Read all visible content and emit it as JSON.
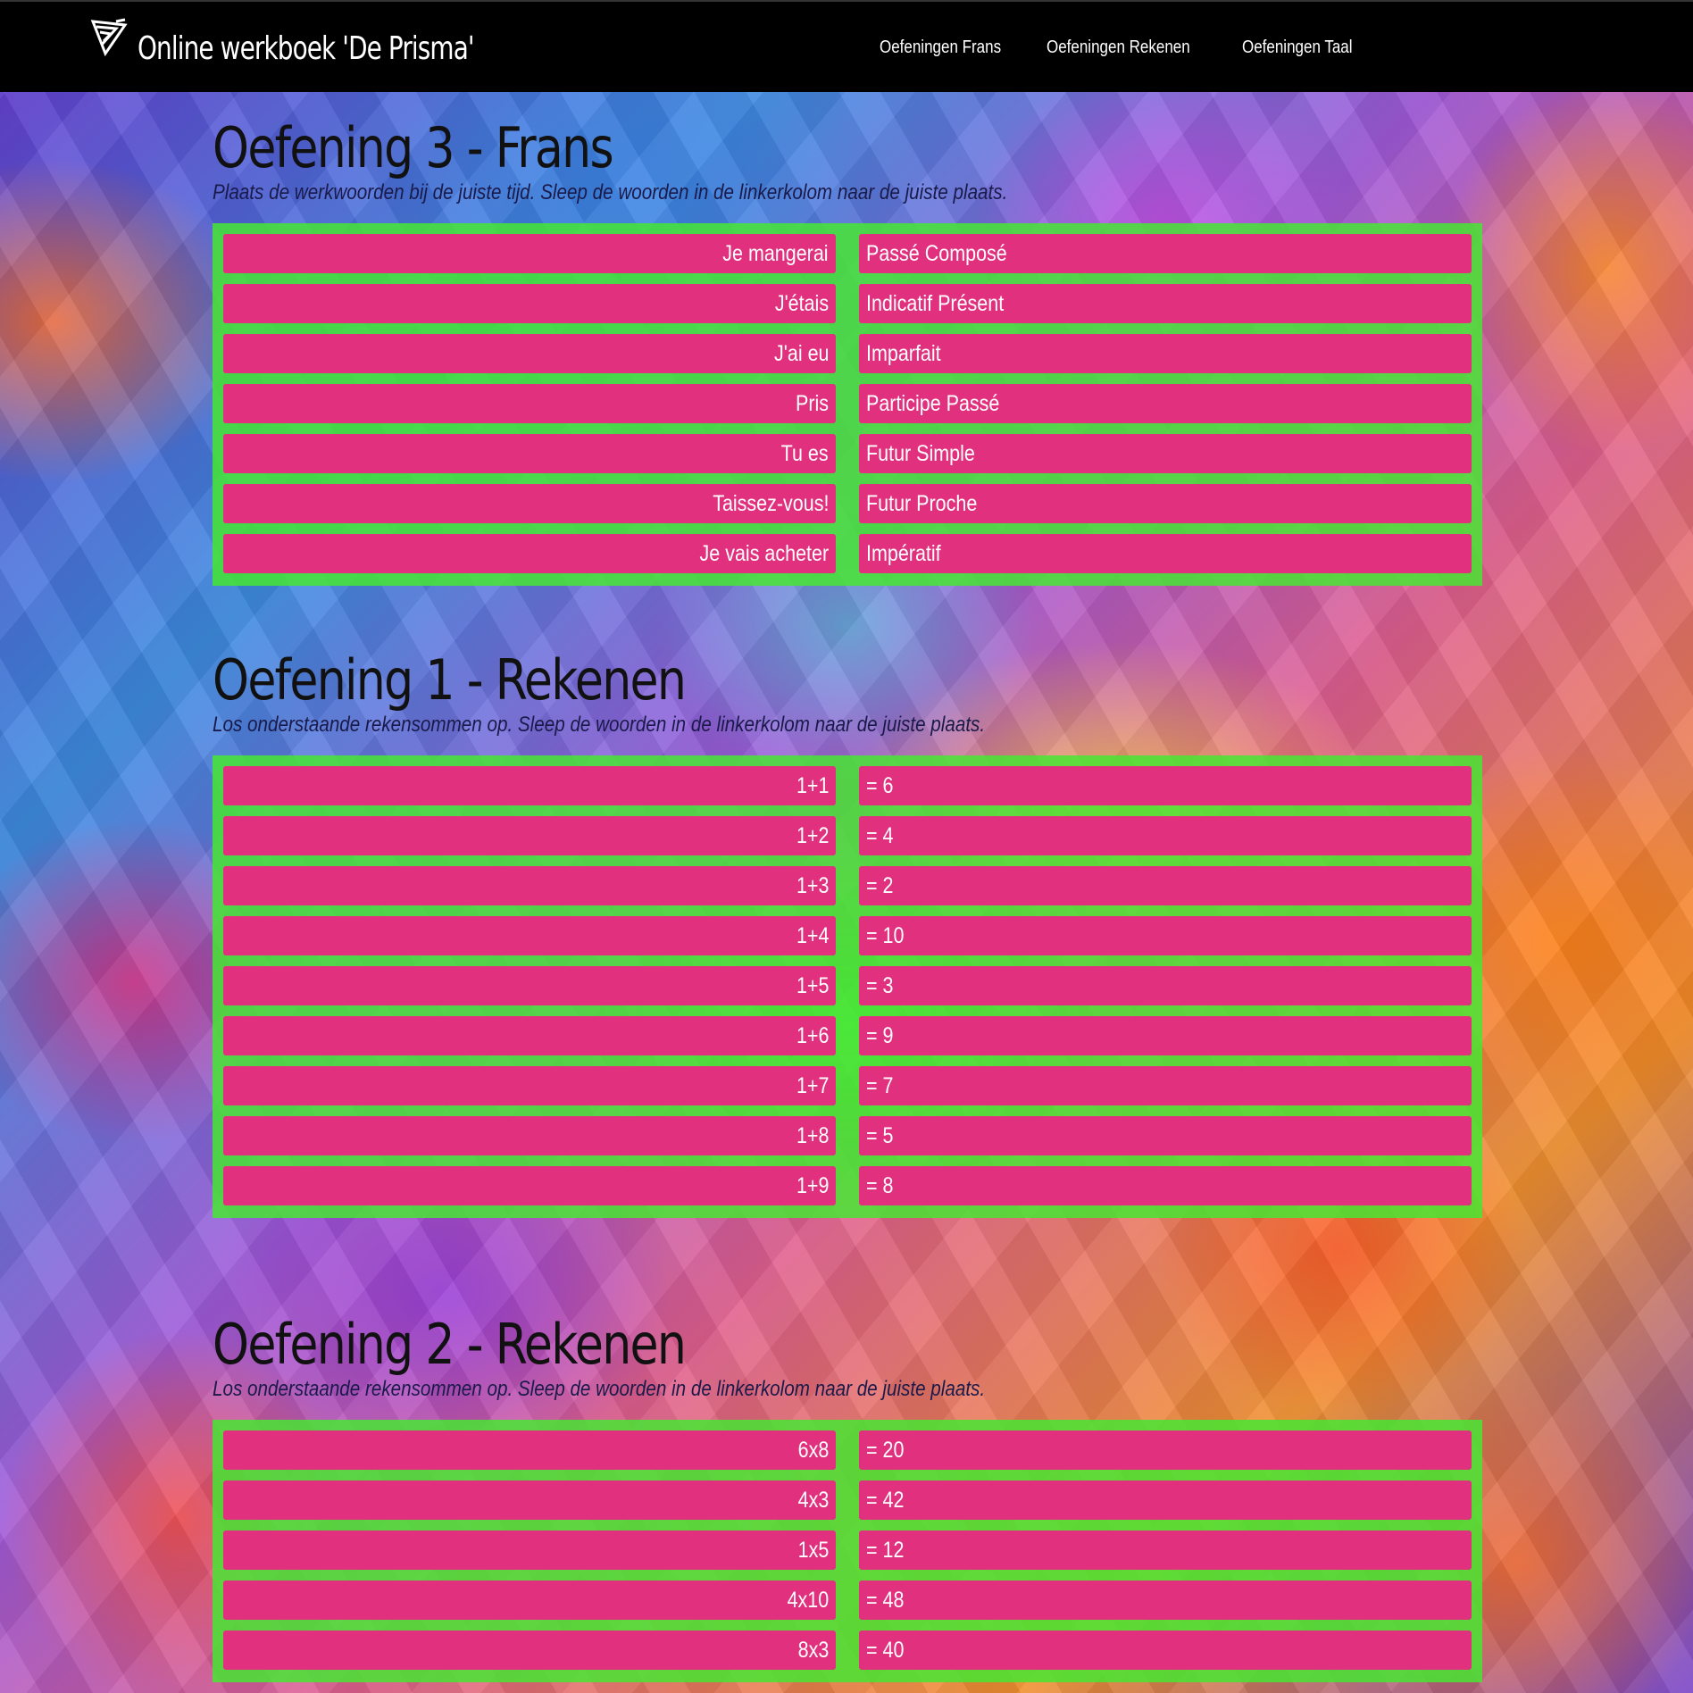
{
  "header": {
    "title": "Online werkboek 'De Prisma'",
    "nav": [
      {
        "label": "Oefeningen Frans"
      },
      {
        "label": "Oefeningen Rekenen"
      },
      {
        "label": "Oefeningen Taal"
      }
    ]
  },
  "colors": {
    "navbar": "#000000",
    "board": "#46e632",
    "cell": "#e0307e",
    "cell_text": "#ffffff"
  },
  "exercises": [
    {
      "title": "Oefening 3 - Frans",
      "description": "Plaats de werkwoorden bij de juiste tijd. Sleep de woorden in de linkerkolom naar de juiste plaats.",
      "left": [
        "Je mangerai",
        "J'étais",
        "J'ai eu",
        "Pris",
        "Tu es",
        "Taissez-vous!",
        "Je vais acheter"
      ],
      "right": [
        "Passé Composé",
        "Indicatif Présent",
        "Imparfait",
        "Participe Passé",
        "Futur Simple",
        "Futur Proche",
        "Impératif"
      ]
    },
    {
      "title": "Oefening 1 - Rekenen",
      "description": "Los onderstaande rekensommen op. Sleep de woorden in de linkerkolom naar de juiste plaats.",
      "left": [
        "1+1",
        "1+2",
        "1+3",
        "1+4",
        "1+5",
        "1+6",
        "1+7",
        "1+8",
        "1+9"
      ],
      "right": [
        "= 6",
        "= 4",
        "= 2",
        "= 10",
        "= 3",
        "= 9",
        "= 7",
        "= 5",
        "= 8"
      ]
    },
    {
      "title": "Oefening 2 - Rekenen",
      "description": "Los onderstaande rekensommen op. Sleep de woorden in de linkerkolom naar de juiste plaats.",
      "left": [
        "6x8",
        "4x3",
        "1x5",
        "4x10",
        "8x3"
      ],
      "right": [
        "= 20",
        "= 42",
        "= 12",
        "= 48",
        "= 40"
      ]
    }
  ]
}
